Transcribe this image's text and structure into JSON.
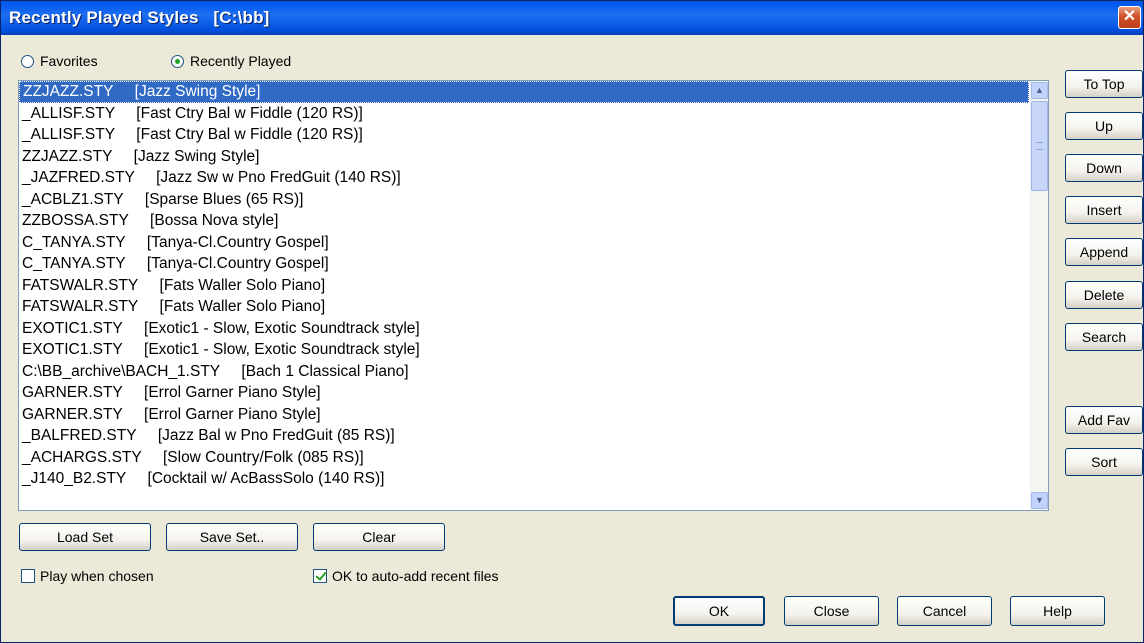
{
  "window": {
    "title": "Recently Played Styles   [C:\\bb]",
    "close_glyph": "✕"
  },
  "radios": {
    "favorites": {
      "label": "Favorites",
      "checked": false
    },
    "recent": {
      "label": "Recently Played",
      "checked": true
    }
  },
  "list": {
    "items": [
      "ZZJAZZ.STY     [Jazz Swing Style]",
      "_ALLISF.STY     [Fast Ctry Bal w Fiddle (120 RS)]",
      "_ALLISF.STY     [Fast Ctry Bal w Fiddle (120 RS)]",
      "ZZJAZZ.STY     [Jazz Swing Style]",
      "_JAZFRED.STY     [Jazz Sw w Pno FredGuit (140 RS)]",
      "_ACBLZ1.STY     [Sparse Blues (65 RS)]",
      "ZZBOSSA.STY     [Bossa Nova style]",
      "C_TANYA.STY     [Tanya-Cl.Country Gospel]",
      "C_TANYA.STY     [Tanya-Cl.Country Gospel]",
      "FATSWALR.STY     [Fats Waller Solo Piano]",
      "FATSWALR.STY     [Fats Waller Solo Piano]",
      "EXOTIC1.STY     [Exotic1 - Slow, Exotic Soundtrack style]",
      "EXOTIC1.STY     [Exotic1 - Slow, Exotic Soundtrack style]",
      "C:\\BB_archive\\BACH_1.STY     [Bach 1 Classical Piano]",
      "GARNER.STY     [Errol Garner Piano Style]",
      "GARNER.STY     [Errol Garner Piano Style]",
      "_BALFRED.STY     [Jazz Bal w Pno FredGuit (85 RS)]",
      "_ACHARGS.STY     [Slow Country/Folk (085 RS)]",
      "_J140_B2.STY     [Cocktail w/ AcBassSolo (140 RS)]"
    ],
    "selected_index": 0,
    "scroll_up_glyph": "▲",
    "scroll_down_glyph": "▼"
  },
  "side_buttons": {
    "to_top": "To Top",
    "up": "Up",
    "down": "Down",
    "insert": "Insert",
    "append": "Append",
    "delete": "Delete",
    "search": "Search",
    "add_fav": "Add Fav",
    "sort": "Sort"
  },
  "set_buttons": {
    "load": "Load Set",
    "save": "Save Set..",
    "clear": "Clear"
  },
  "options": {
    "play_when_chosen": {
      "label": "Play when chosen",
      "checked": false
    },
    "auto_add": {
      "label": "OK to auto-add recent files",
      "checked": true
    }
  },
  "footer_buttons": {
    "ok": "OK",
    "close": "Close",
    "cancel": "Cancel",
    "help": "Help"
  },
  "colors": {
    "title_bar": "#0058ee",
    "selection": "#316ac5",
    "dialog_bg": "#ece9d8"
  }
}
